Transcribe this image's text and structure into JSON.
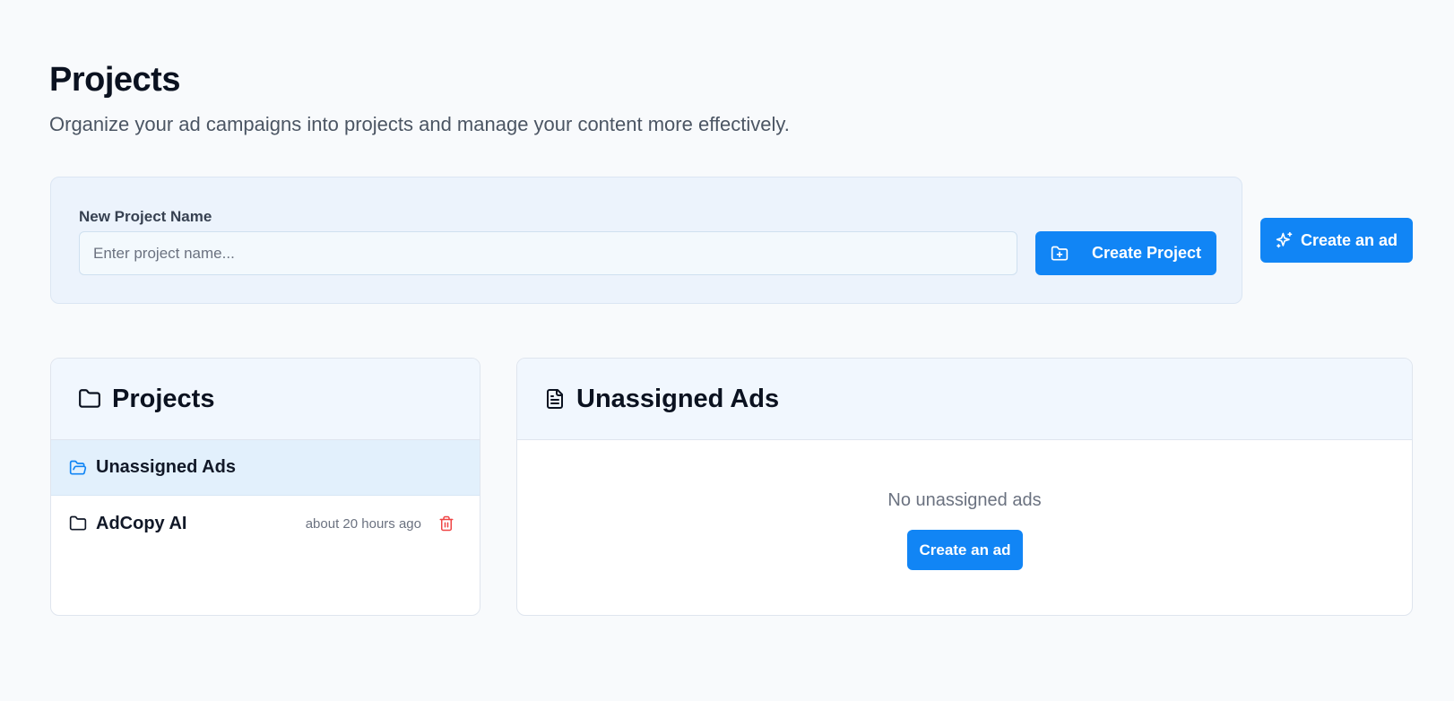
{
  "header": {
    "title": "Projects",
    "subtitle": "Organize your ad campaigns into projects and manage your content more effectively."
  },
  "new_project": {
    "label": "New Project Name",
    "input_value": "",
    "placeholder": "Enter project name...",
    "create_button_label": "Create Project"
  },
  "create_ad_button_label": "Create an ad",
  "projects_panel": {
    "title": "Projects",
    "items": [
      {
        "label": "Unassigned Ads",
        "icon": "folder-open-icon",
        "selected": true
      },
      {
        "label": "AdCopy AI",
        "icon": "folder-icon",
        "time": "about 20 hours ago",
        "action_icon": "trash-icon"
      }
    ]
  },
  "ads_panel": {
    "title": "Unassigned Ads",
    "empty_text": "No unassigned ads",
    "create_button_label": "Create an ad"
  },
  "colors": {
    "accent": "#1185f5",
    "danger": "#ef4444",
    "page_background": "#f8fafc",
    "panel_header": "#f1f7fe",
    "selected_row": "#e2f0fc"
  }
}
